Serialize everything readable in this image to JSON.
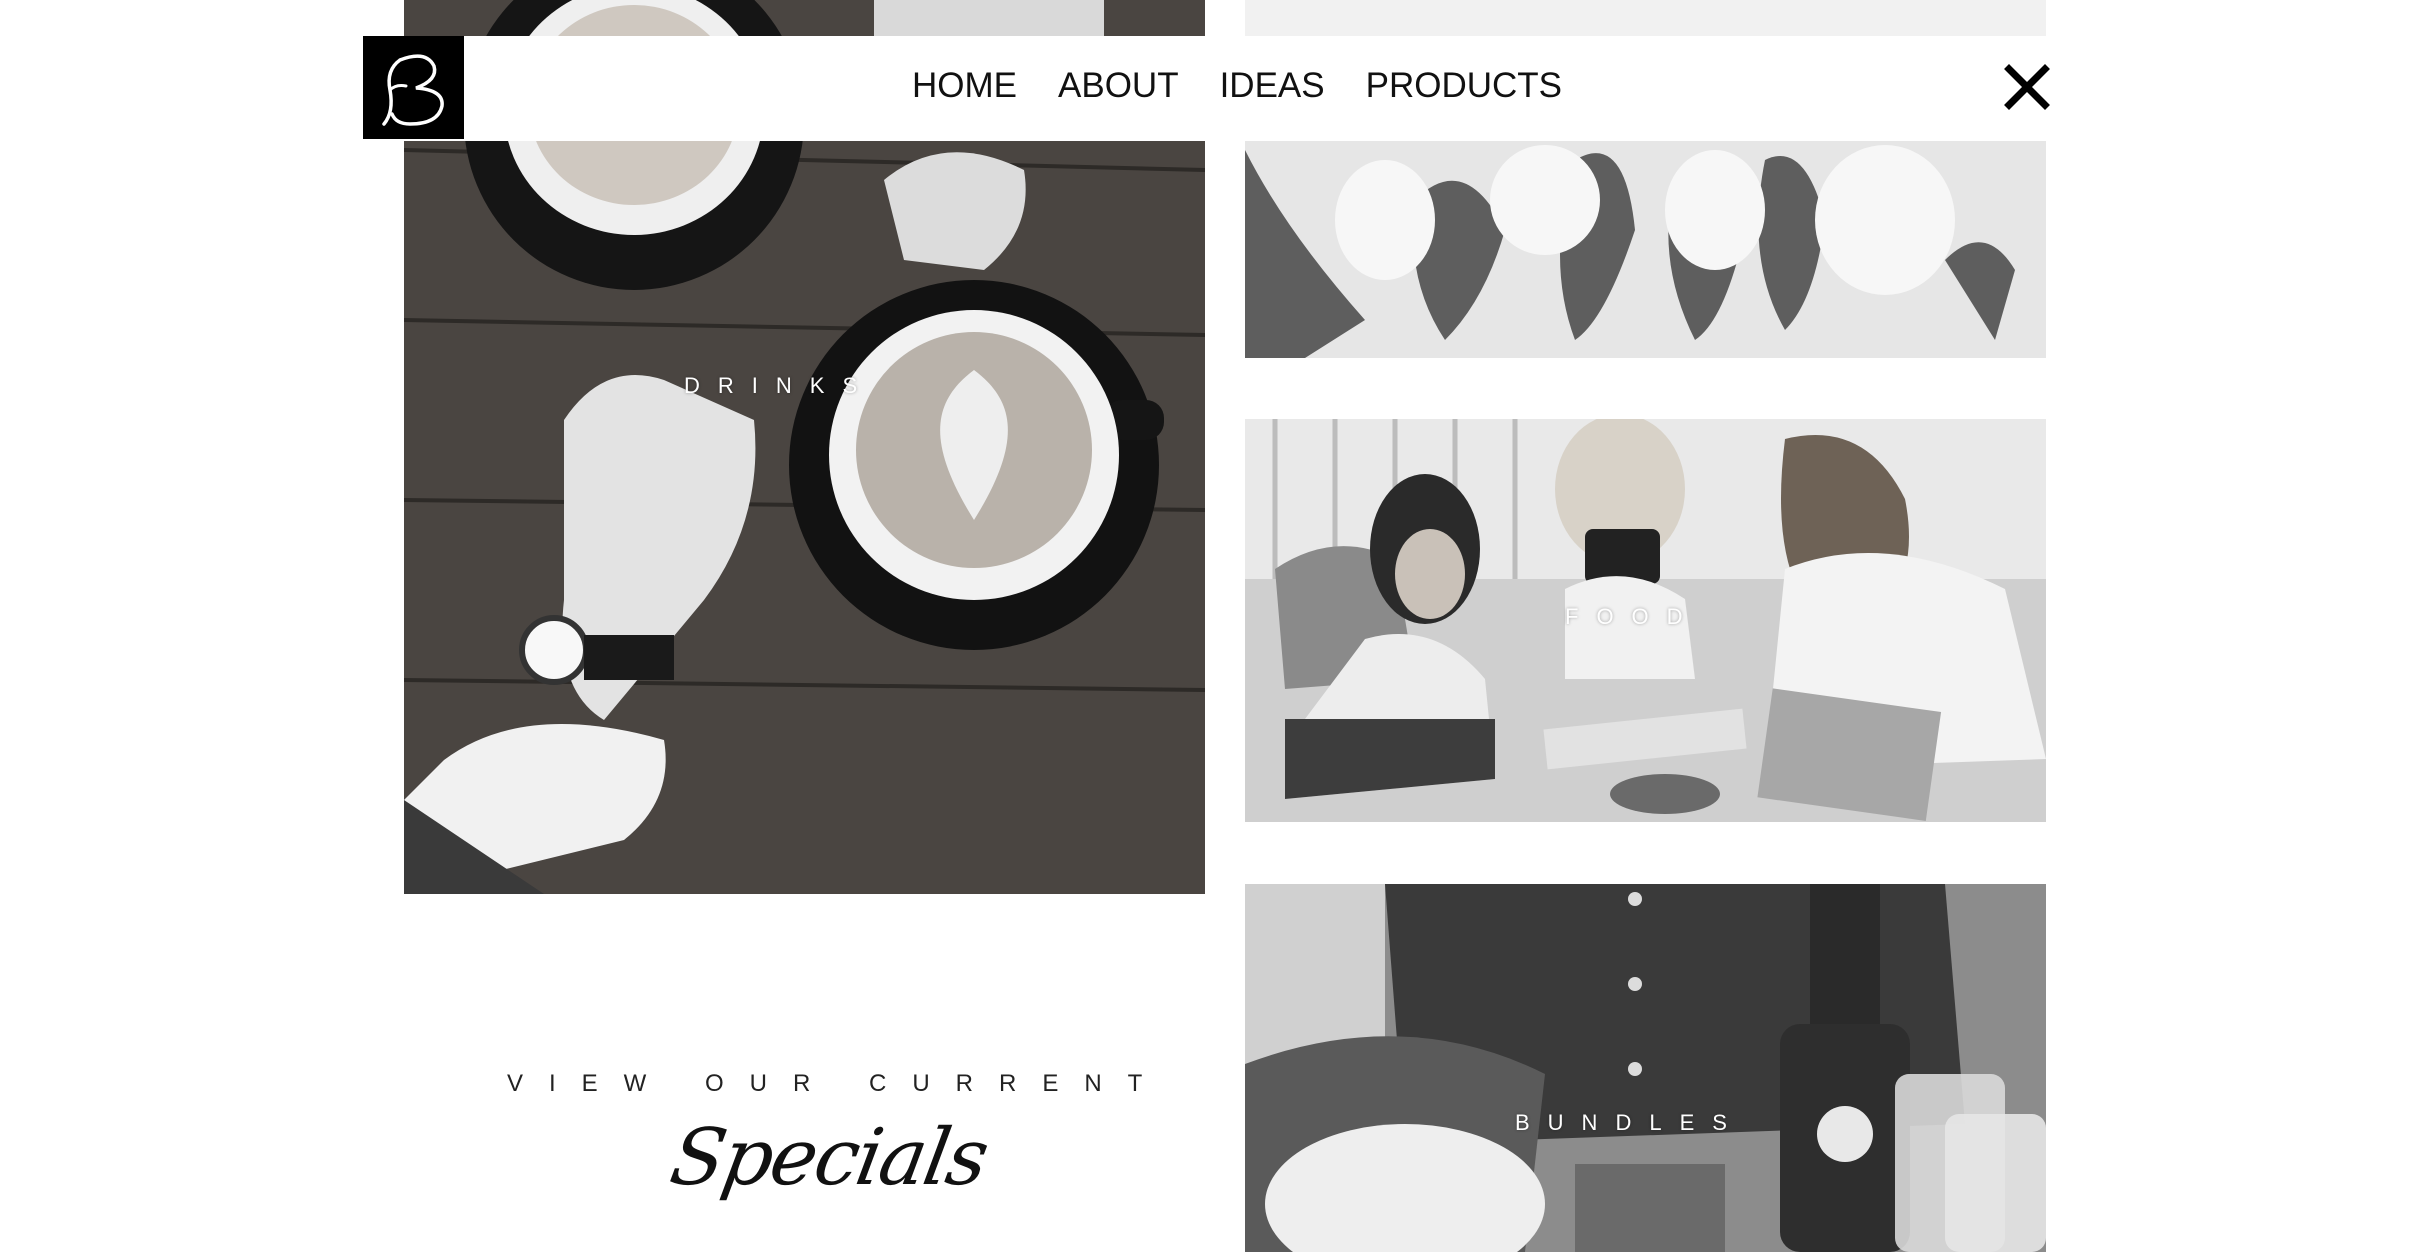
{
  "brand": {
    "logo_letter": "B"
  },
  "nav": {
    "items": [
      {
        "label": "HOME"
      },
      {
        "label": "ABOUT"
      },
      {
        "label": "IDEAS"
      },
      {
        "label": "PRODUCTS"
      }
    ],
    "close_icon": "close-icon"
  },
  "tiles": {
    "drinks": {
      "label": "DRINKS"
    },
    "food": {
      "label": "FOOD"
    },
    "bundles": {
      "label": "BUNDLES"
    }
  },
  "specials": {
    "kicker": "VIEW OUR CURRENT",
    "title": "Specials"
  }
}
